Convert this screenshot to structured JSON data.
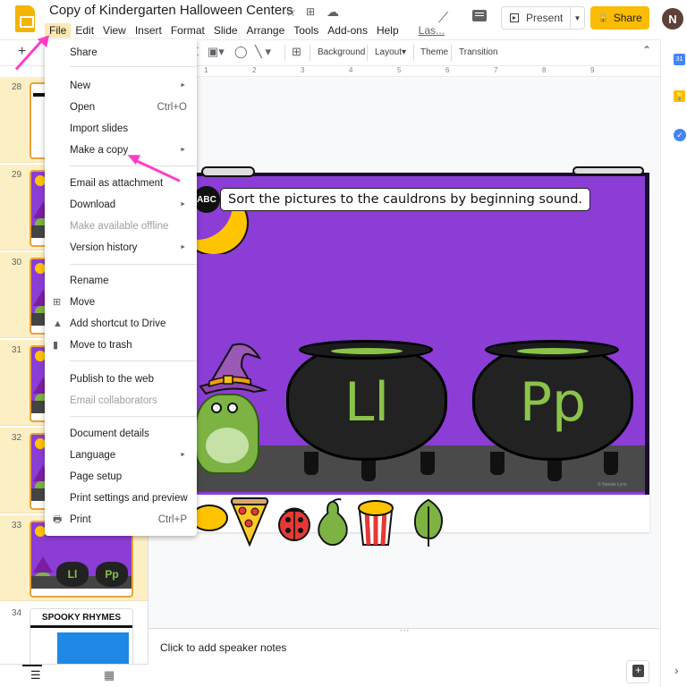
{
  "app": {
    "title": "Copy of Kindergarten Halloween Centers",
    "title_icons": [
      "star-icon",
      "move-to-folder-icon",
      "cloud-saved-icon"
    ],
    "menu": [
      "File",
      "Edit",
      "View",
      "Insert",
      "Format",
      "Slide",
      "Arrange",
      "Tools",
      "Add-ons",
      "Help"
    ],
    "last_edit": "Las...",
    "active_menu": "File"
  },
  "header": {
    "present_label": "Present",
    "share_label": "Share",
    "avatar_initial": "N",
    "share_color": "#fbbc04"
  },
  "toolbar": {
    "add": "+",
    "buttons": [
      "Background",
      "Layout",
      "Theme",
      "Transition"
    ],
    "layout_dropdown": "▾"
  },
  "ruler": {
    "ticks": [
      "1",
      "2",
      "3",
      "4",
      "5",
      "6",
      "7",
      "8",
      "9"
    ]
  },
  "file_menu": {
    "items": [
      {
        "label": "Share"
      },
      {
        "label": "New",
        "submenu": true
      },
      {
        "label": "Open",
        "shortcut": "Ctrl+O"
      },
      {
        "label": "Import slides"
      },
      {
        "label": "Make a copy",
        "submenu": true
      },
      {
        "label": "Email as attachment"
      },
      {
        "label": "Download",
        "submenu": true
      },
      {
        "label": "Make available offline",
        "disabled": true
      },
      {
        "label": "Version history",
        "submenu": true
      },
      {
        "label": "Rename"
      },
      {
        "label": "Move",
        "icon": "folder-move-icon"
      },
      {
        "label": "Add shortcut to Drive",
        "icon": "drive-shortcut-icon"
      },
      {
        "label": "Move to trash",
        "icon": "trash-icon"
      },
      {
        "label": "Publish to the web"
      },
      {
        "label": "Email collaborators",
        "disabled": true
      },
      {
        "label": "Document details"
      },
      {
        "label": "Language",
        "submenu": true
      },
      {
        "label": "Page setup"
      },
      {
        "label": "Print settings and preview"
      },
      {
        "label": "Print",
        "shortcut": "Ctrl+P",
        "icon": "printer-icon"
      }
    ]
  },
  "filmstrip": {
    "slides": [
      {
        "number": "28",
        "selected": true
      },
      {
        "number": "29",
        "selected": true
      },
      {
        "number": "30",
        "selected": true
      },
      {
        "number": "31",
        "selected": true
      },
      {
        "number": "32",
        "selected": true
      },
      {
        "number": "33",
        "selected": true
      },
      {
        "number": "34",
        "selected": false,
        "title": "SPOOKY RHYMES"
      }
    ],
    "thumb_letters": [
      "Ll",
      "Pp"
    ]
  },
  "slide": {
    "badge": "ABC",
    "instruction": "Sort the pictures to the cauldrons by beginning sound.",
    "cauldrons": [
      "Ll",
      "Pp"
    ],
    "copyright": "© Natalie Lynn",
    "items": [
      "lemon",
      "pizza",
      "ladybug",
      "pear",
      "popcorn",
      "leaf"
    ],
    "background_color": "#8b3dd6"
  },
  "notes": {
    "placeholder": "Click to add speaker notes"
  },
  "side_panel": {
    "calendar_label": "31",
    "apps": [
      "calendar-icon",
      "keep-icon",
      "tasks-icon"
    ]
  }
}
